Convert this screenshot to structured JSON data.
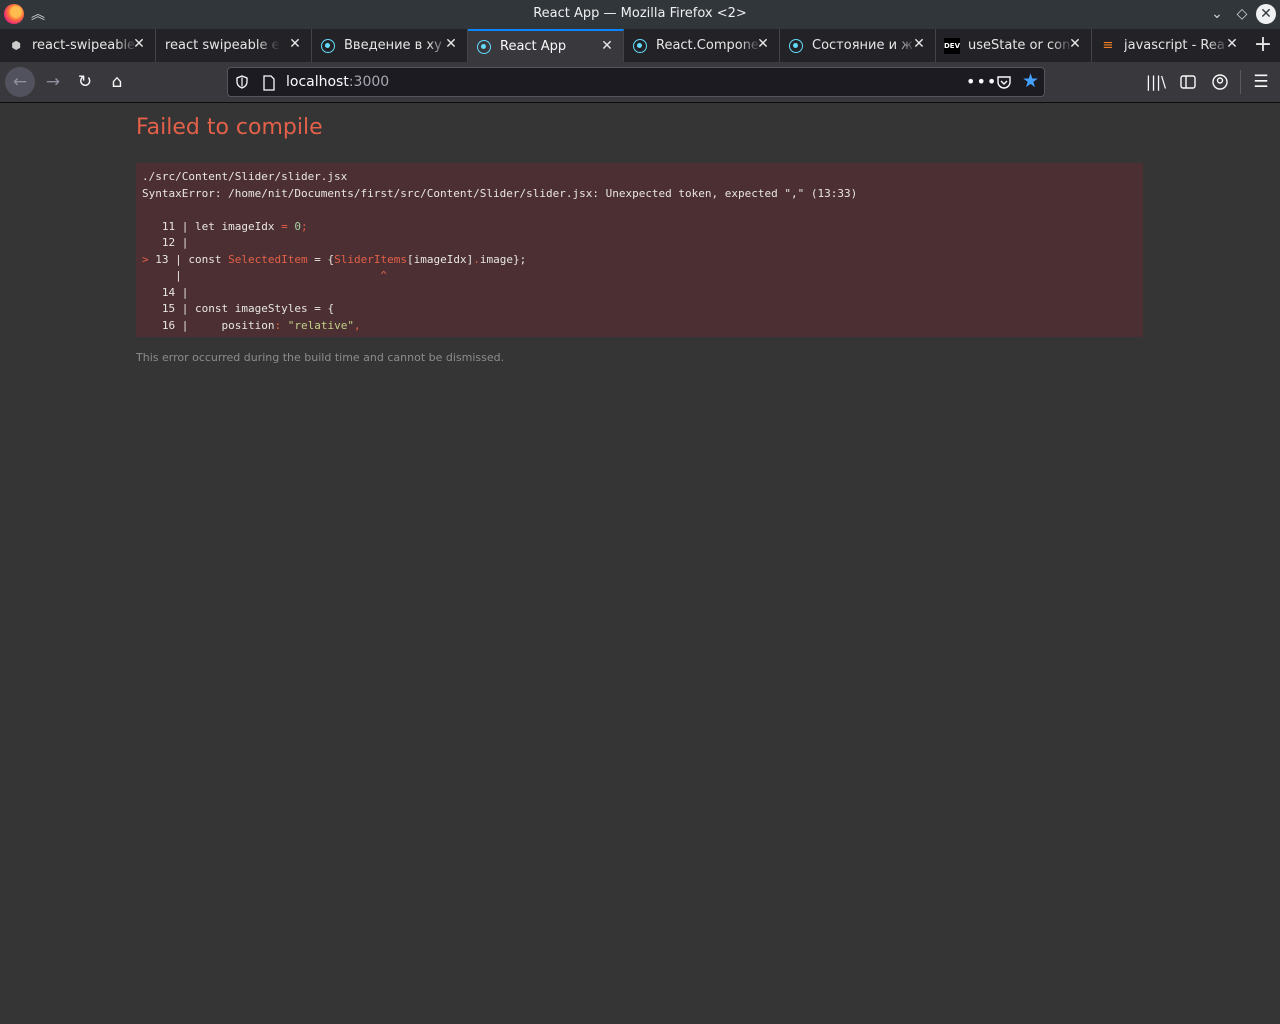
{
  "window": {
    "title": "React App — Mozilla Firefox <2>"
  },
  "tabs": [
    {
      "label": "react-swipeable",
      "favicon": "box-icon"
    },
    {
      "label": "react swipeable ex",
      "favicon": "none"
    },
    {
      "label": "Введение в ху",
      "favicon": "react-icon"
    },
    {
      "label": "React App",
      "favicon": "react-icon",
      "active": true
    },
    {
      "label": "React.Compone",
      "favicon": "react-icon"
    },
    {
      "label": "Состояние и ж",
      "favicon": "react-icon"
    },
    {
      "label": "useState or con",
      "favicon": "dev-icon",
      "favicon_text": "DEV"
    },
    {
      "label": "javascript - Rea",
      "favicon": "stackoverflow-icon"
    }
  ],
  "urlbar": {
    "host": "localhost",
    "port": ":3000"
  },
  "error": {
    "title": "Failed to compile",
    "file": "./src/Content/Slider/slider.jsx",
    "message": "SyntaxError: /home/nit/Documents/first/src/Content/Slider/slider.jsx: Unexpected token, expected \",\" (13:33)",
    "lines": [
      {
        "marker": " ",
        "num": "11",
        "code_kw": "let imageIdx ",
        "code_op": "= ",
        "code_num": "0",
        "code_tail": ";"
      },
      {
        "marker": " ",
        "num": "12",
        "code": ""
      },
      {
        "marker": ">",
        "num": "13",
        "code_a": "const ",
        "code_b": "SelectedItem",
        "code_c": " = {",
        "code_d": "SliderItems",
        "code_e": "[imageIdx]",
        "code_f": ".",
        "code_g": "image",
        "code_h": "};"
      },
      {
        "marker": " ",
        "num": "",
        "caret": "^"
      },
      {
        "marker": " ",
        "num": "14",
        "code": ""
      },
      {
        "marker": " ",
        "num": "15",
        "code": "const imageStyles = {"
      },
      {
        "marker": " ",
        "num": "16",
        "code_a": "    position",
        "code_b": ": ",
        "code_c": "\"relative\"",
        "code_d": ","
      }
    ],
    "footnote": "This error occurred during the build time and cannot be dismissed."
  }
}
